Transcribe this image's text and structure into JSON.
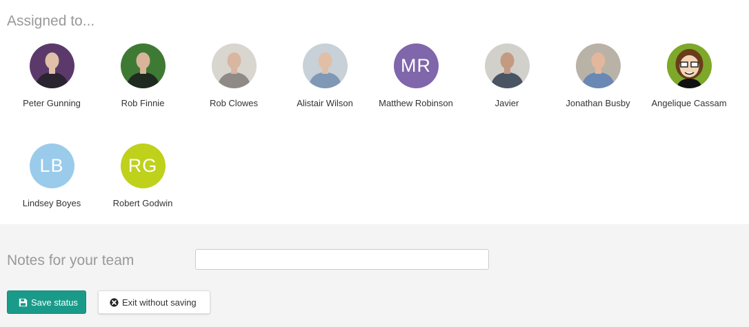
{
  "assigned": {
    "title": "Assigned to..."
  },
  "people": [
    {
      "name": "Peter Gunning",
      "avatar": "photo",
      "colors": [
        "#5b3a6b",
        "#2a2430",
        "#e0c0a8"
      ]
    },
    {
      "name": "Rob Finnie",
      "avatar": "photo",
      "colors": [
        "#3f7a35",
        "#1f2a20",
        "#d8b49a"
      ]
    },
    {
      "name": "Rob Clowes",
      "avatar": "photo",
      "colors": [
        "#d9d6d0",
        "#8f8a86",
        "#d9b6a0"
      ]
    },
    {
      "name": "Alistair Wilson",
      "avatar": "photo",
      "colors": [
        "#c8d0d8",
        "#7e98b6",
        "#e0bfa6"
      ]
    },
    {
      "name": "Matthew Robinson",
      "avatar": "initials",
      "initials": "MR",
      "color": "#8066aa"
    },
    {
      "name": "Javier",
      "avatar": "photo",
      "colors": [
        "#d2d0ca",
        "#4a5564",
        "#c49a82"
      ]
    },
    {
      "name": "Jonathan Busby",
      "avatar": "photo",
      "colors": [
        "#b9b2a7",
        "#6a88b4",
        "#e2b79c"
      ]
    },
    {
      "name": "Angelique Cassam",
      "avatar": "cartoon",
      "colors": [
        "#7ea82a",
        "#6a3c1a",
        "#f3d6b8"
      ]
    },
    {
      "name": "Lindsey Boyes",
      "avatar": "initials",
      "initials": "LB",
      "color": "#9acbeb"
    },
    {
      "name": "Robert Godwin",
      "avatar": "initials",
      "initials": "RG",
      "color": "#bfd11b"
    }
  ],
  "notes": {
    "label": "Notes for your team",
    "value": "",
    "placeholder": ""
  },
  "buttons": {
    "save_label": "Save status",
    "save_icon": "floppy-disk-icon",
    "exit_label": "Exit without saving",
    "exit_icon": "close-circle-icon"
  },
  "colors": {
    "accent": "#1a9b8a",
    "section_bg": "#f4f4f4",
    "muted_text": "#999999"
  }
}
